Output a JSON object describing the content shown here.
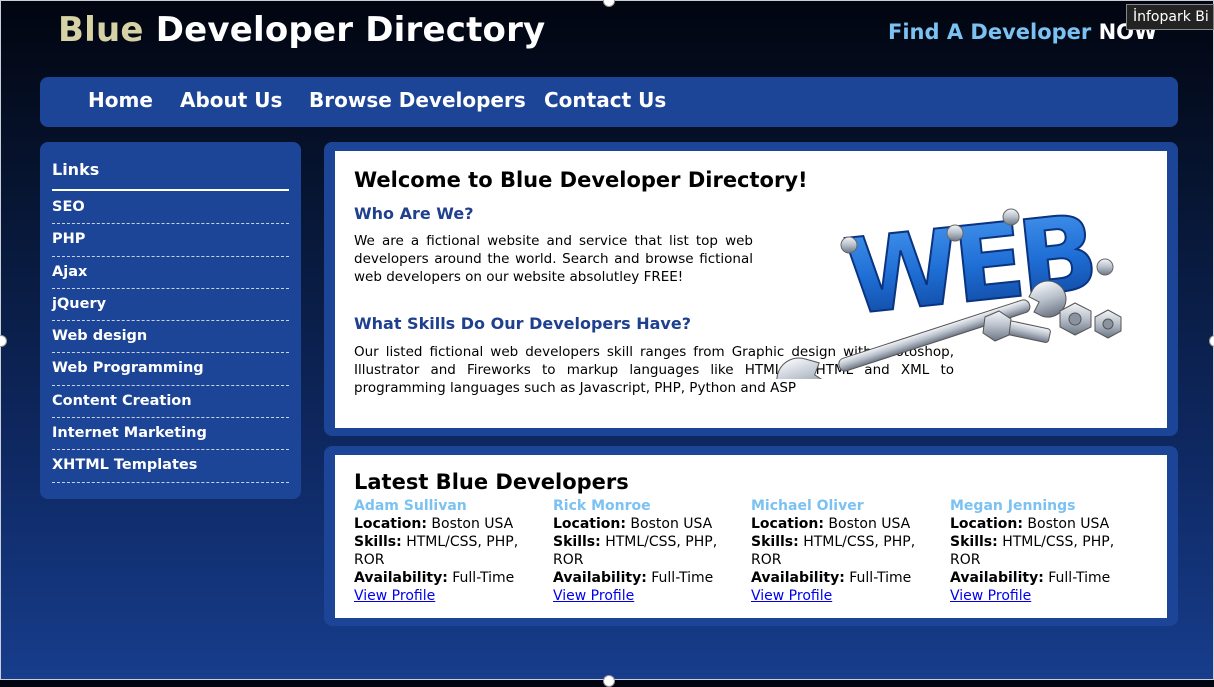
{
  "header": {
    "title_blue": "Blue",
    "title_rest": "Developer Directory",
    "tagline_main": "Find A Developer",
    "tagline_now": "NOW"
  },
  "overlay": {
    "label": "İnfopark Bi"
  },
  "nav": {
    "items": [
      {
        "label": "Home"
      },
      {
        "label": "About Us"
      },
      {
        "label": "Browse Developers"
      },
      {
        "label": "Contact Us"
      }
    ]
  },
  "sidebar": {
    "heading": "Links",
    "items": [
      {
        "label": "SEO"
      },
      {
        "label": "PHP"
      },
      {
        "label": "Ajax"
      },
      {
        "label": "jQuery"
      },
      {
        "label": "Web design"
      },
      {
        "label": "Web Programming"
      },
      {
        "label": "Content Creation"
      },
      {
        "label": "Internet Marketing"
      },
      {
        "label": "XHTML Templates"
      }
    ]
  },
  "welcome": {
    "title": "Welcome to Blue Developer Directory!",
    "who_heading": "Who Are We?",
    "who_text": "We are a fictional website and service that list top web developers around the world. Search and browse fictional web developers on our website absolutley FREE!",
    "skills_heading": "What Skills Do Our Developers Have?",
    "skills_text": "Our listed fictional web developers skill ranges from Graphic design with Photoshop, Illustrator and Fireworks to markup languages like HTML5, XHTML and XML to programming languages such as Javascript, PHP, Python and ASP",
    "image_text": "WEB",
    "colors": {
      "accent": "#1f3f8f",
      "image_blue": "#1f6fd6"
    }
  },
  "latest": {
    "title": "Latest Blue Developers",
    "labels": {
      "location": "Location:",
      "skills": "Skills:",
      "availability": "Availability:"
    },
    "developers": [
      {
        "name": "Adam Sullivan",
        "location": "Boston USA",
        "skills": "HTML/CSS, PHP, ROR",
        "availability": "Full-Time",
        "link": "View Profile"
      },
      {
        "name": "Rick Monroe",
        "location": "Boston USA",
        "skills": "HTML/CSS, PHP, ROR",
        "availability": "Full-Time",
        "link": "View Profile"
      },
      {
        "name": "Michael Oliver",
        "location": "Boston USA",
        "skills": "HTML/CSS, PHP, ROR",
        "availability": "Full-Time",
        "link": "View Profile"
      },
      {
        "name": "Megan Jennings",
        "location": "Boston USA",
        "skills": "HTML/CSS, PHP, ROR",
        "availability": "Full-Time",
        "link": "View Profile"
      }
    ]
  },
  "theme": {
    "nav_bg": "#1c4597",
    "name_color": "#7bc2f2",
    "link_color": "#0000ee"
  }
}
